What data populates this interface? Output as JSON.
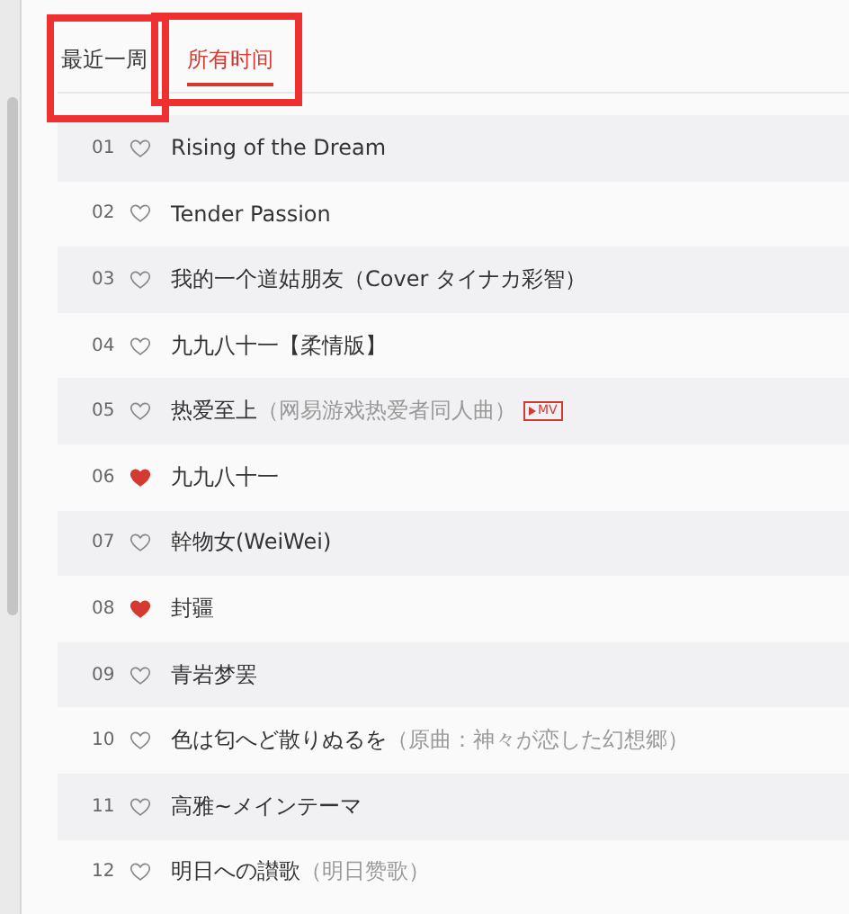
{
  "tabs": [
    {
      "label": "最近一周",
      "selected": false
    },
    {
      "label": "所有时间",
      "selected": true
    }
  ],
  "songs": [
    {
      "number": "01",
      "liked": false,
      "title": "Rising of the Dream"
    },
    {
      "number": "02",
      "liked": false,
      "title": "Tender Passion"
    },
    {
      "number": "03",
      "liked": false,
      "title": "我的一个道姑朋友（Cover タイナカ彩智）"
    },
    {
      "number": "04",
      "liked": false,
      "title": "九九八十一【柔情版】"
    },
    {
      "number": "05",
      "liked": false,
      "title": "热爱至上",
      "subtitle": "（网易游戏热爱者同人曲）",
      "badge": "MV"
    },
    {
      "number": "06",
      "liked": true,
      "title": "九九八十一"
    },
    {
      "number": "07",
      "liked": false,
      "title": "幹物女(WeiWei)"
    },
    {
      "number": "08",
      "liked": true,
      "title": "封疆"
    },
    {
      "number": "09",
      "liked": false,
      "title": "青岩梦罢"
    },
    {
      "number": "10",
      "liked": false,
      "title": "色は匂へど散りぬるを",
      "subtitle": "（原曲：神々が恋した幻想郷）"
    },
    {
      "number": "11",
      "liked": false,
      "title": "高雅~メインテーマ"
    },
    {
      "number": "12",
      "liked": false,
      "title": "明日への讃歌",
      "subtitle": "（明日赞歌）"
    }
  ]
}
